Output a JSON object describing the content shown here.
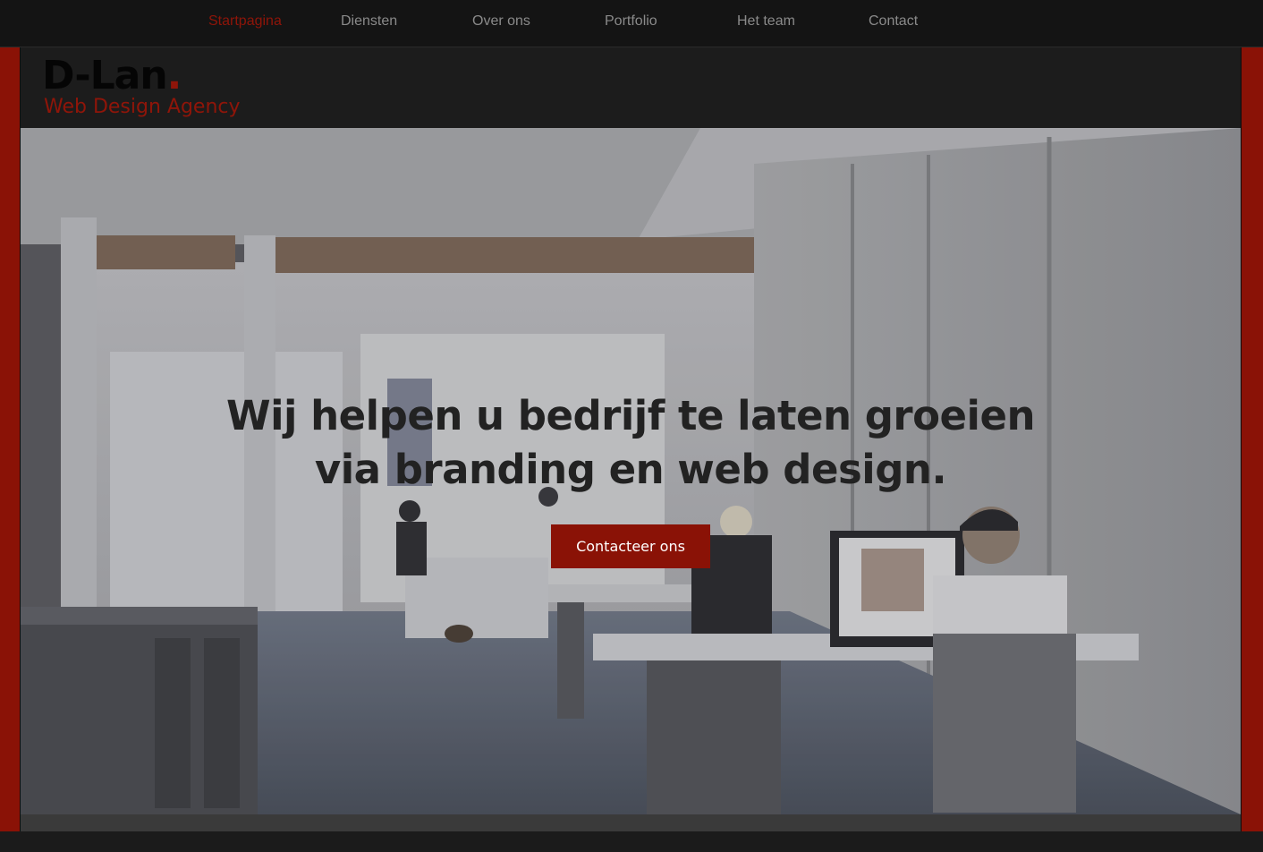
{
  "nav": {
    "items": [
      {
        "label": "Startpagina",
        "active": true
      },
      {
        "label": "Diensten",
        "active": false
      },
      {
        "label": "Over ons",
        "active": false
      },
      {
        "label": "Portfolio",
        "active": false
      },
      {
        "label": "Het team",
        "active": false
      },
      {
        "label": "Contact",
        "active": false
      }
    ]
  },
  "logo": {
    "mark": "D-Lan",
    "dot": ".",
    "tagline": "Web Design Agency"
  },
  "hero": {
    "title_line1": "Wij helpen u bedrijf te laten groeien",
    "title_line2": "via branding en web design.",
    "cta_label": "Contacteer ons",
    "background_image": "office-photo"
  },
  "colors": {
    "accent": "#8a1206",
    "nav_background": "#141414",
    "header_background": "#1c1c1c",
    "nav_text": "#8a8a8a",
    "hero_title": "#222222"
  }
}
